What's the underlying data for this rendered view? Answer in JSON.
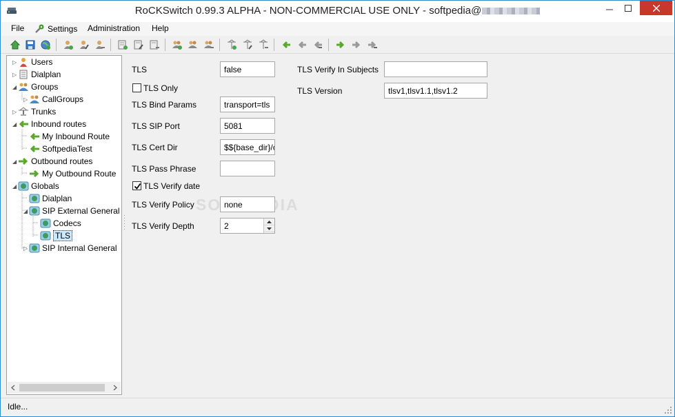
{
  "window": {
    "title": "RoCKSwitch 0.99.3 ALPHA - NON-COMMERCIAL USE ONLY - softpedia@",
    "close_color": "#c7372c"
  },
  "menu": {
    "file": "File",
    "settings": "Settings",
    "administration": "Administration",
    "help": "Help"
  },
  "toolbar": {
    "icons": [
      "home-icon",
      "save-icon",
      "globe-icon",
      "add-user-icon",
      "edit-user-icon",
      "remove-user-icon",
      "add-dialplan-icon",
      "edit-dialplan-icon",
      "remove-dialplan-icon",
      "add-group-icon",
      "edit-group-icon",
      "remove-group-icon",
      "add-trunk-icon",
      "edit-trunk-icon",
      "remove-trunk-icon",
      "add-inbound-icon",
      "edit-inbound-icon",
      "remove-inbound-icon",
      "add-outbound-icon",
      "edit-outbound-icon",
      "remove-outbound-icon"
    ]
  },
  "tree": {
    "items": [
      {
        "label": "Users"
      },
      {
        "label": "Dialplan"
      },
      {
        "label": "Groups"
      },
      {
        "label": "CallGroups"
      },
      {
        "label": "Trunks"
      },
      {
        "label": "Inbound routes"
      },
      {
        "label": "My Inbound Route"
      },
      {
        "label": "SoftpediaTest"
      },
      {
        "label": "Outbound routes"
      },
      {
        "label": "My Outbound Route"
      },
      {
        "label": "Globals"
      },
      {
        "label": "Dialplan"
      },
      {
        "label": "SIP External General"
      },
      {
        "label": "Codecs"
      },
      {
        "label": "TLS"
      },
      {
        "label": "SIP Internal General"
      }
    ]
  },
  "form": {
    "tls_label": "TLS",
    "tls_value": "false",
    "tls_only_label": "TLS Only",
    "tls_only_checked": false,
    "bind_params_label": "TLS Bind Params",
    "bind_params_value": "transport=tls",
    "sip_port_label": "TLS SIP Port",
    "sip_port_value": "5081",
    "cert_dir_label": "TLS Cert Dir",
    "cert_dir_value": "$${base_dir}/c",
    "pass_phrase_label": "TLS Pass Phrase",
    "pass_phrase_value": "",
    "verify_date_label": "TLS Verify date",
    "verify_date_checked": true,
    "verify_policy_label": "TLS Verify Policy",
    "verify_policy_value": "none",
    "verify_depth_label": "TLS Verify Depth",
    "verify_depth_value": "2",
    "verify_subjects_label": "TLS Verify In Subjects",
    "verify_subjects_value": "",
    "version_label": "TLS Version",
    "version_value": "tlsv1,tlsv1.1,tlsv1.2"
  },
  "watermark": "SOFTPEDIA",
  "status": {
    "text": "Idle..."
  }
}
